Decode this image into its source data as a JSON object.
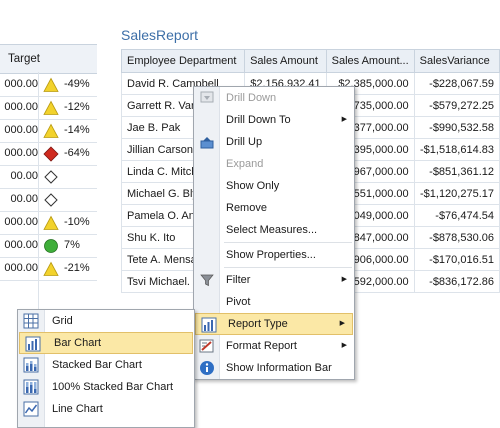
{
  "scorecard": {
    "header": "Target",
    "rows": [
      {
        "value": "000.00",
        "indicator": "triangle",
        "pct": "-49%"
      },
      {
        "value": "000.00",
        "indicator": "triangle",
        "pct": "-12%"
      },
      {
        "value": "000.00",
        "indicator": "triangle",
        "pct": "-14%"
      },
      {
        "value": "000.00",
        "indicator": "diamond-red",
        "pct": "-64%"
      },
      {
        "value": "00.00",
        "indicator": "diamond-empty",
        "pct": ""
      },
      {
        "value": "00.00",
        "indicator": "diamond-empty",
        "pct": ""
      },
      {
        "value": "000.00",
        "indicator": "triangle",
        "pct": "-10%"
      },
      {
        "value": "000.00",
        "indicator": "circle-green",
        "pct": "7%"
      },
      {
        "value": "000.00",
        "indicator": "triangle",
        "pct": "-21%"
      }
    ],
    "colors": {
      "triangle": "#f2d22c",
      "red": "#cf2a1f",
      "green": "#3fae3a"
    }
  },
  "report": {
    "title": "SalesReport",
    "columns": [
      "Employee Department",
      "Sales Amount",
      "Sales Amount...",
      "SalesVariance"
    ],
    "rows": [
      [
        "David R. Campbell",
        "$2,156,932.41",
        "$2,385,000.00",
        "-$228,067.59"
      ],
      [
        "Garrett R. Varg",
        "",
        "735,000.00",
        "-$579,272.25"
      ],
      [
        "Jae B. Pak",
        "",
        "377,000.00",
        "-$990,532.58"
      ],
      [
        "Jillian Carson",
        "",
        "395,000.00",
        "-$1,518,614.83"
      ],
      [
        "Linda C. Mitche",
        "",
        "967,000.00",
        "-$851,361.12"
      ],
      [
        "Michael G. Blyt",
        "",
        "551,000.00",
        "-$1,120,275.17"
      ],
      [
        "Pamela O. Ans",
        "",
        "049,000.00",
        "-$76,474.54"
      ],
      [
        "Shu K. Ito",
        "",
        "847,000.00",
        "-$878,530.06"
      ],
      [
        "Tete A. Mensa",
        "",
        "906,000.00",
        "-$170,016.51"
      ],
      [
        "Tsvi Michael. R",
        "",
        "592,000.00",
        "-$836,172.86"
      ]
    ]
  },
  "context_menu": {
    "items": [
      {
        "label": "Drill Down",
        "disabled": true,
        "icon": "drill-down-icon"
      },
      {
        "label": "Drill Down To",
        "submenu": true
      },
      {
        "label": "Drill Up",
        "icon": "drill-up-icon"
      },
      {
        "label": "Expand",
        "disabled": true
      },
      {
        "label": "Show Only"
      },
      {
        "label": "Remove"
      },
      {
        "label": "Select Measures..."
      },
      {
        "label": "Show Properties..."
      },
      {
        "label": "Filter",
        "submenu": true,
        "icon": "filter-icon"
      },
      {
        "label": "Pivot"
      },
      {
        "label": "Report Type",
        "submenu": true,
        "highlighted": true,
        "icon": "bar-chart-icon"
      },
      {
        "label": "Format Report",
        "submenu": true,
        "icon": "format-report-icon"
      },
      {
        "label": "Show Information Bar",
        "icon": "info-icon"
      }
    ]
  },
  "report_type_submenu": {
    "items": [
      {
        "label": "Grid",
        "icon": "grid-icon"
      },
      {
        "label": "Bar Chart",
        "icon": "bar-chart-icon",
        "highlighted": true
      },
      {
        "label": "Stacked Bar Chart",
        "icon": "stacked-bar-chart-icon"
      },
      {
        "label": "100% Stacked Bar Chart",
        "icon": "stacked-100-bar-chart-icon"
      },
      {
        "label": "Line Chart",
        "icon": "line-chart-icon"
      }
    ]
  }
}
